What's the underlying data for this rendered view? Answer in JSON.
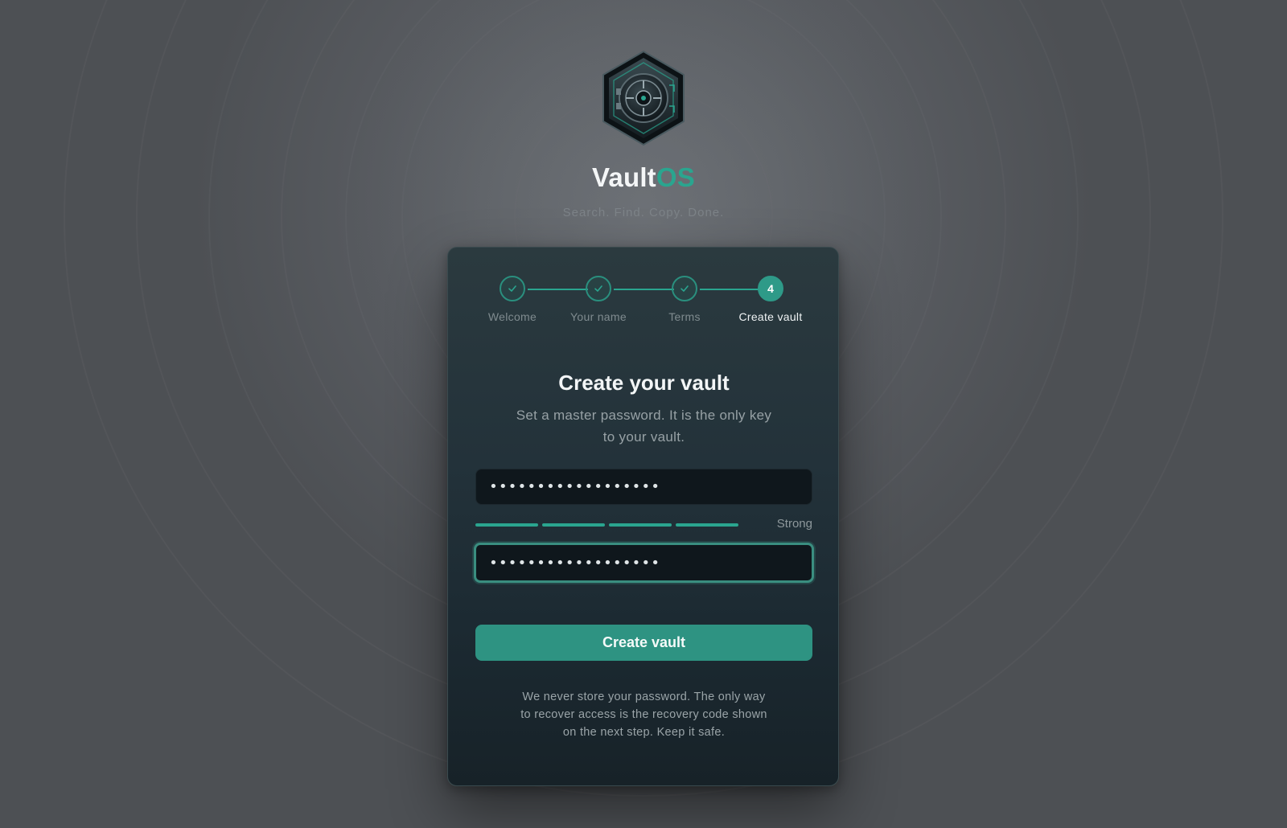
{
  "brand": {
    "name_main": "Vault",
    "name_accent": "OS",
    "tagline": "Search. Find. Copy. Done.",
    "logo_icon": "vault-safe-icon"
  },
  "steps": [
    {
      "label": "Welcome",
      "state": "done"
    },
    {
      "label": "Your name",
      "state": "done"
    },
    {
      "label": "Terms",
      "state": "done"
    },
    {
      "label": "Create vault",
      "state": "current",
      "number": "4"
    }
  ],
  "form": {
    "title": "Create your vault",
    "subtitle": "Set a master password. It is the only key to your vault.",
    "password_value": "••••••••••••••••••",
    "confirm_value": "••••••••••••••••••",
    "strength_label": "Strong",
    "strength_level": "4/4",
    "submit_label": "Create vault",
    "note": "We never store your password. The only way to recover access is the recovery code shown on the next step. Keep it safe."
  },
  "colors": {
    "accent": "#2aa58f",
    "button": "#2e9382",
    "card": "#23323a",
    "background": "#5a5d62"
  }
}
